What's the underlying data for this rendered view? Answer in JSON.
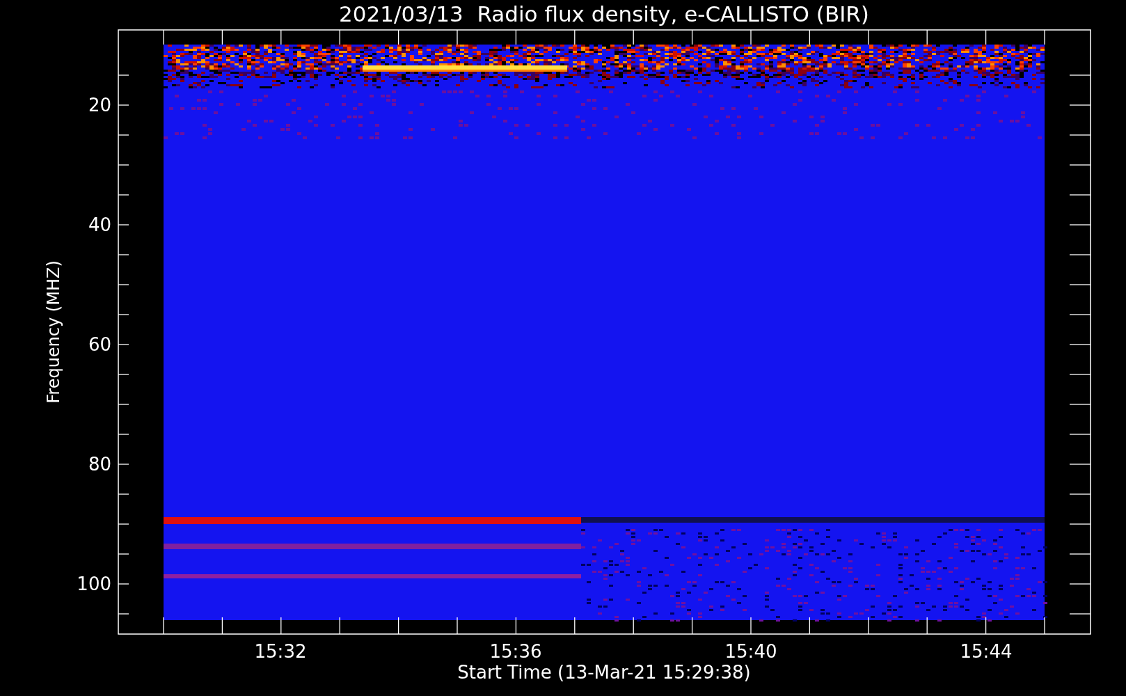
{
  "title": "2021/03/13  Radio flux density, e-CALLISTO (BIR)",
  "xlabel": "Start Time (13-Mar-21 15:29:38)",
  "ylabel": "Frequency (MHZ)",
  "yticks": [
    "20",
    "40",
    "60",
    "80",
    "100"
  ],
  "xticks": [
    "15:32",
    "15:36",
    "15:40",
    "15:44"
  ]
}
